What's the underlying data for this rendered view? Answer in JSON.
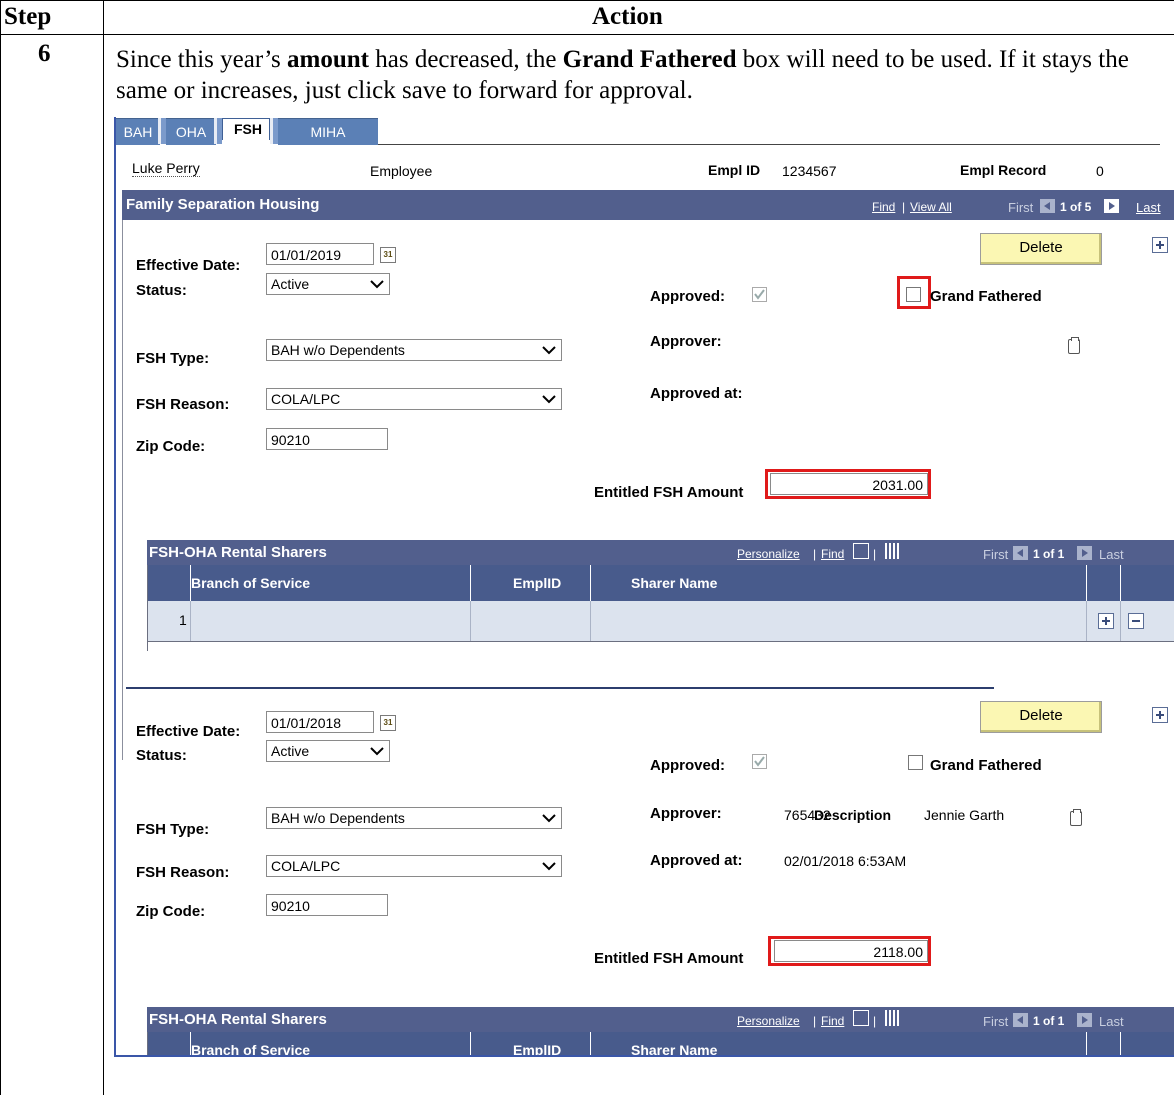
{
  "table": {
    "step_header": "Step",
    "action_header": "Action",
    "step_number": "6",
    "instruction": {
      "p1": "Since this year’s ",
      "b1": "amount",
      "p2": " has decreased, the ",
      "b2": "Grand Fathered",
      "p3": " box will need to be used. If it stays the same or increases, just click save to forward for approval."
    }
  },
  "tabs": [
    "BAH",
    "OHA",
    "FSH",
    "MIHA"
  ],
  "selected_tab": "FSH",
  "employee": {
    "name": "Luke Perry",
    "role": "Employee",
    "empl_id_label": "Empl ID",
    "empl_id": "1234567",
    "empl_record_label": "Empl Record",
    "empl_record": "0"
  },
  "section": {
    "title": "Family Separation Housing",
    "find": "Find",
    "sep": "|",
    "view_all": "View All",
    "first": "First",
    "range": "1 of 5",
    "last": "Last"
  },
  "labels": {
    "effective_date": "Effective Date:",
    "status": "Status:",
    "fsh_type": "FSH Type:",
    "fsh_reason": "FSH Reason:",
    "zip_code": "Zip Code:",
    "approved": "Approved:",
    "grand_fathered": "Grand Fathered",
    "approver": "Approver:",
    "approved_at": "Approved at:",
    "entitled_amount": "Entitled FSH Amount",
    "delete": "Delete"
  },
  "records": [
    {
      "effective_date": "01/01/2019",
      "status": "Active",
      "fsh_type": "BAH w/o Dependents",
      "fsh_reason": "COLA/LPC",
      "zip_code": "90210",
      "approver_value": "",
      "approved_at_value": "",
      "entitled_amount": "2031.00",
      "approved_checked": true,
      "grand_fathered_checked": false
    },
    {
      "effective_date": "01/01/2018",
      "status": "Active",
      "fsh_type": "BAH w/o Dependents",
      "fsh_reason": "COLA/LPC",
      "zip_code": "90210",
      "approver_value": "765432",
      "approver_overlap": "Description",
      "approver_name": "Jennie Garth",
      "approved_at_value": "02/01/2018 6:53AM",
      "entitled_amount": "2118.00",
      "approved_checked": true,
      "grand_fathered_checked": false
    }
  ],
  "grid": {
    "title": "FSH-OHA Rental Sharers",
    "personalize": "Personalize",
    "find": "Find",
    "first": "First",
    "range": "1 of 1",
    "last": "Last",
    "columns": [
      "Branch of Service",
      "EmplID",
      "Sharer Name"
    ],
    "row_number": "1"
  },
  "icons": {
    "calendar": "calendar-icon",
    "note": "note-icon",
    "add": "add-row-icon",
    "delete_row": "delete-row-icon",
    "nav_prev": "prev-arrow-icon",
    "nav_next": "next-arrow-icon",
    "zoom": "zoom-icon",
    "download": "download-icon"
  },
  "colors": {
    "header_bar": "#525f8d",
    "tab_blue": "#5b80b6",
    "button_yellow": "#fbf7b3",
    "highlight_red": "#e01a1a"
  }
}
